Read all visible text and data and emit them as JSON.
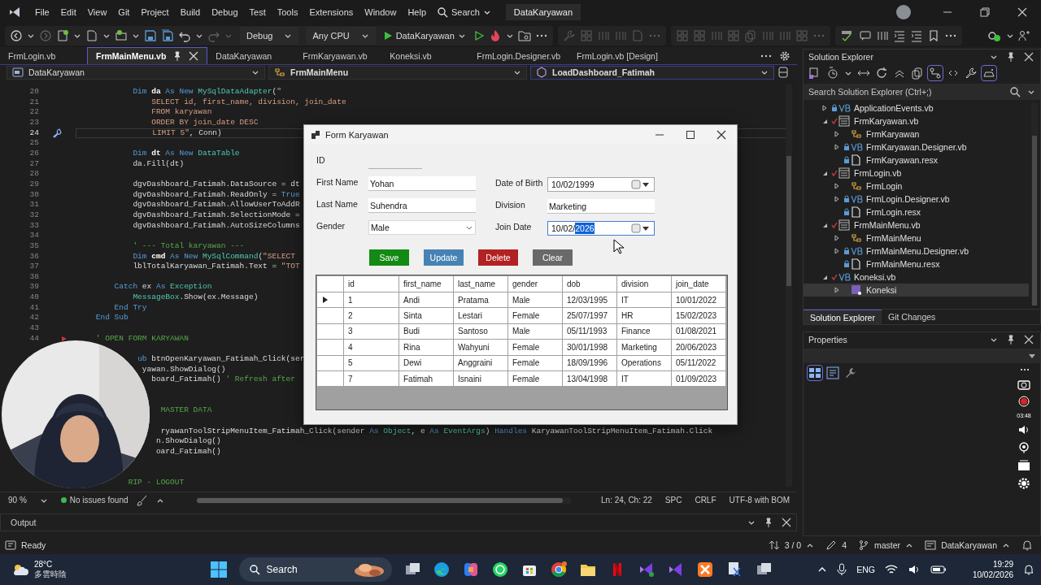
{
  "window": {
    "title": "DataKaryawan"
  },
  "menu": [
    "File",
    "Edit",
    "View",
    "Git",
    "Project",
    "Build",
    "Debug",
    "Test",
    "Tools",
    "Extensions",
    "Window",
    "Help"
  ],
  "search": {
    "label": "Search"
  },
  "toolbar": {
    "forward": {
      "disabled": true
    },
    "redo": {
      "disabled": true
    },
    "debug_tools": {
      "disabled": true
    },
    "configuration": "Debug",
    "platform": "Any CPU",
    "start": "DataKaryawan"
  },
  "editor_tabs": [
    {
      "label": "FrmLogin.vb",
      "selected": false
    },
    {
      "label": "FrmMainMenu.vb",
      "selected": true
    },
    {
      "label": "DataKaryawan",
      "selected": false
    },
    {
      "label": "FrmKaryawan.vb",
      "selected": false
    },
    {
      "label": "Koneksi.vb",
      "selected": false
    },
    {
      "label": "FrmLogin.Designer.vb",
      "selected": false
    },
    {
      "label": "FrmLogin.vb [Design]",
      "selected": false
    }
  ],
  "nav_bar": {
    "project": "DataKaryawan",
    "class": "FrmMainMenu",
    "member": "LoadDashboard_Fatimah"
  },
  "code_lines": [
    {
      "kind": "code",
      "number": "20",
      "tokens": [
        {
          "kind": "keyword",
          "text": "            Dim "
        },
        {
          "kind": "local",
          "text": "da"
        },
        {
          "kind": "keyword",
          "text": " As New "
        },
        {
          "kind": "type",
          "text": "MySqlDataAdapter"
        },
        {
          "kind": "plain",
          "text": "("
        },
        {
          "kind": "string",
          "text": "\""
        }
      ]
    },
    {
      "kind": "code",
      "number": "21",
      "tokens": [
        {
          "kind": "string",
          "text": "                SELECT id, first_name, division, join_date"
        }
      ]
    },
    {
      "kind": "code",
      "number": "22",
      "tokens": [
        {
          "kind": "string",
          "text": "                FROM karyawan"
        }
      ]
    },
    {
      "kind": "code",
      "number": "23",
      "tokens": [
        {
          "kind": "string",
          "text": "                ORDER BY join_date DESC"
        }
      ]
    },
    {
      "kind": "code",
      "number": "24",
      "current": true,
      "tokens": [
        {
          "kind": "string",
          "text": "                LIMIT 5\""
        },
        {
          "kind": "plain",
          "text": ", Conn)"
        }
      ]
    },
    {
      "kind": "blank",
      "number": "25"
    },
    {
      "kind": "code",
      "number": "26",
      "tokens": [
        {
          "kind": "keyword",
          "text": "            Dim "
        },
        {
          "kind": "local",
          "text": "dt"
        },
        {
          "kind": "keyword",
          "text": " As New "
        },
        {
          "kind": "type",
          "text": "DataTable"
        }
      ]
    },
    {
      "kind": "code",
      "number": "27",
      "tokens": [
        {
          "kind": "plain",
          "text": "            da.Fill(dt)"
        }
      ]
    },
    {
      "kind": "blank",
      "number": "28"
    },
    {
      "kind": "code",
      "number": "29",
      "tokens": [
        {
          "kind": "plain",
          "text": "            dgvDashboard_Fatimah.DataSource = dt"
        }
      ]
    },
    {
      "kind": "code",
      "number": "30",
      "tokens": [
        {
          "kind": "plain",
          "text": "            dgvDashboard_Fatimah.ReadOnly = "
        },
        {
          "kind": "keyword",
          "text": "True"
        }
      ]
    },
    {
      "kind": "code",
      "number": "31",
      "tokens": [
        {
          "kind": "plain",
          "text": "            dgvDashboard_Fatimah.AllowUserToAddR"
        }
      ]
    },
    {
      "kind": "code",
      "number": "32",
      "tokens": [
        {
          "kind": "plain",
          "text": "            dgvDashboard_Fatimah.SelectionMode ="
        }
      ]
    },
    {
      "kind": "code",
      "number": "33",
      "tokens": [
        {
          "kind": "plain",
          "text": "            dgvDashboard_Fatimah.AutoSizeColumns"
        }
      ]
    },
    {
      "kind": "blank",
      "number": "34"
    },
    {
      "kind": "code",
      "number": "35",
      "tokens": [
        {
          "kind": "comment",
          "text": "            ' --- Total karyawan ---"
        }
      ]
    },
    {
      "kind": "code",
      "number": "36",
      "tokens": [
        {
          "kind": "keyword",
          "text": "            Dim "
        },
        {
          "kind": "local",
          "text": "cmd"
        },
        {
          "kind": "keyword",
          "text": " As New "
        },
        {
          "kind": "type",
          "text": "MySqlCommand"
        },
        {
          "kind": "plain",
          "text": "("
        },
        {
          "kind": "string",
          "text": "\"SELECT"
        }
      ]
    },
    {
      "kind": "code",
      "number": "37",
      "tokens": [
        {
          "kind": "plain",
          "text": "            lblTotalKaryawan_Fatimah.Text = "
        },
        {
          "kind": "string",
          "text": "\"TOT"
        }
      ]
    },
    {
      "kind": "blank",
      "number": "38"
    },
    {
      "kind": "code",
      "number": "39",
      "tokens": [
        {
          "kind": "keyword",
          "text": "        Catch "
        },
        {
          "kind": "plain",
          "text": "ex "
        },
        {
          "kind": "keyword",
          "text": "As "
        },
        {
          "kind": "type",
          "text": "Exception"
        }
      ]
    },
    {
      "kind": "code",
      "number": "40",
      "tokens": [
        {
          "kind": "type",
          "text": "            MessageBox"
        },
        {
          "kind": "plain",
          "text": ".Show(ex.Message)"
        }
      ]
    },
    {
      "kind": "code",
      "number": "41",
      "tokens": [
        {
          "kind": "keyword",
          "text": "        End Try"
        }
      ]
    },
    {
      "kind": "code",
      "number": "42",
      "tokens": [
        {
          "kind": "keyword",
          "text": "    End Sub"
        }
      ]
    },
    {
      "kind": "blank",
      "number": "43"
    },
    {
      "kind": "code",
      "number": "44",
      "marker": true,
      "tokens": [
        {
          "kind": "comment",
          "text": "    ' OPEN FORM KARYAWAN"
        }
      ]
    },
    {
      "kind": "blank"
    },
    {
      "kind": "code",
      "tokens": [
        {
          "kind": "keyword",
          "text": "             ub "
        },
        {
          "kind": "plain",
          "text": "btnOpenKaryawan_Fatimah_Click(ser"
        }
      ]
    },
    {
      "kind": "code",
      "tokens": [
        {
          "kind": "plain",
          "text": "              yawan.ShowDialog()"
        }
      ]
    },
    {
      "kind": "code",
      "tokens": [
        {
          "kind": "plain",
          "text": "                board_Fatimah() "
        },
        {
          "kind": "comment",
          "text": "' Refresh after"
        }
      ]
    },
    {
      "kind": "blank"
    },
    {
      "kind": "blank"
    },
    {
      "kind": "code",
      "tokens": [
        {
          "kind": "comment",
          "text": "                  MASTER DATA"
        }
      ]
    },
    {
      "kind": "blank"
    },
    {
      "kind": "code",
      "tokens": [
        {
          "kind": "plain",
          "text": "                  ryawanToolStripMenuItem_Fatimah_Click(sender "
        },
        {
          "kind": "keyword",
          "text": "As "
        },
        {
          "kind": "type",
          "text": "Object"
        },
        {
          "kind": "plain",
          "text": ", e "
        },
        {
          "kind": "keyword",
          "text": "As "
        },
        {
          "kind": "type",
          "text": "EventArgs"
        },
        {
          "kind": "plain",
          "text": ") "
        },
        {
          "kind": "keyword",
          "text": "Handles "
        },
        {
          "kind": "plain",
          "text": "KaryawanToolStripMenuItem_Fatimah.Click"
        }
      ]
    },
    {
      "kind": "code",
      "tokens": [
        {
          "kind": "plain",
          "text": "                 n.ShowDialog()"
        }
      ]
    },
    {
      "kind": "code",
      "tokens": [
        {
          "kind": "plain",
          "text": "                 oard_Fatimah()"
        }
      ]
    },
    {
      "kind": "blank"
    },
    {
      "kind": "blank"
    },
    {
      "kind": "code",
      "tokens": [
        {
          "kind": "comment",
          "text": "           RIP - LOGOUT"
        }
      ]
    }
  ],
  "editor_status": {
    "zoom": "90 %",
    "issues": "No issues found",
    "position": "Ln: 24, Ch: 22",
    "indent": "SPC",
    "line_endings": "CRLF",
    "encoding": "UTF-8 with BOM"
  },
  "output_panel": {
    "title": "Output"
  },
  "solution_explorer": {
    "title": "Solution Explorer",
    "search_placeholder": "Search Solution Explorer (Ctrl+;)",
    "items": [
      {
        "label": "ApplicationEvents.vb",
        "kind": "vb",
        "locked": true,
        "modified": false,
        "expanded": false,
        "selected": false
      },
      {
        "label": "FrmKaryawan.vb",
        "kind": "form",
        "locked": false,
        "modified": true,
        "expanded": true,
        "selected": false,
        "children": [
          {
            "label": "FrmKaryawan",
            "kind": "class",
            "locked": false,
            "modified": false,
            "expanded": false,
            "selected": false
          },
          {
            "label": "FrmKaryawan.Designer.vb",
            "kind": "vb",
            "locked": true,
            "modified": false,
            "expanded": false,
            "selected": false
          },
          {
            "label": "FrmKaryawan.resx",
            "kind": "resx",
            "locked": true,
            "modified": false,
            "selected": false
          }
        ]
      },
      {
        "label": "FrmLogin.vb",
        "kind": "form",
        "locked": false,
        "modified": true,
        "expanded": true,
        "selected": false,
        "children": [
          {
            "label": "FrmLogin",
            "kind": "class",
            "locked": false,
            "modified": false,
            "expanded": false,
            "selected": false
          },
          {
            "label": "FrmLogin.Designer.vb",
            "kind": "vb",
            "locked": true,
            "modified": false,
            "expanded": false,
            "selected": false
          },
          {
            "label": "FrmLogin.resx",
            "kind": "resx",
            "locked": true,
            "modified": false,
            "selected": false
          }
        ]
      },
      {
        "label": "FrmMainMenu.vb",
        "kind": "form",
        "locked": false,
        "modified": true,
        "expanded": true,
        "selected": false,
        "children": [
          {
            "label": "FrmMainMenu",
            "kind": "class",
            "locked": false,
            "modified": false,
            "expanded": false,
            "selected": false
          },
          {
            "label": "FrmMainMenu.Designer.vb",
            "kind": "vb",
            "locked": true,
            "modified": false,
            "expanded": false,
            "selected": false
          },
          {
            "label": "FrmMainMenu.resx",
            "kind": "resx",
            "locked": true,
            "modified": false,
            "selected": false
          }
        ]
      },
      {
        "label": "Koneksi.vb",
        "kind": "vb",
        "locked": false,
        "modified": true,
        "expanded": true,
        "selected": false,
        "children": [
          {
            "label": "Koneksi",
            "kind": "module",
            "locked": false,
            "modified": false,
            "expanded": false,
            "selected": true
          }
        ]
      }
    ],
    "tabs": [
      {
        "label": "Solution Explorer",
        "selected": true
      },
      {
        "label": "Git Changes",
        "selected": false
      }
    ]
  },
  "properties": {
    "title": "Properties"
  },
  "recorder": {
    "timer": "03:48"
  },
  "form": {
    "title": "Form Karyawan",
    "left_fields": [
      {
        "label": "ID",
        "kind": "underline"
      },
      {
        "label": "First Name",
        "kind": "text",
        "value": "Yohan"
      },
      {
        "label": "Last Name",
        "kind": "text",
        "value": "Suhendra"
      },
      {
        "label": "Gender",
        "kind": "combo",
        "value": "Male"
      }
    ],
    "right_fields": [
      {
        "label": "Date of Birth",
        "kind": "date",
        "focused": false,
        "value_parts": [
          {
            "text": "10/02/1999",
            "highlighted": false
          }
        ]
      },
      {
        "label": "Division",
        "kind": "text",
        "value": "Marketing"
      },
      {
        "label": "Join Date",
        "kind": "date",
        "focused": true,
        "value_parts": [
          {
            "text": "10/02/",
            "highlighted": false
          },
          {
            "text": "2026",
            "highlighted": true
          }
        ]
      }
    ],
    "buttons": [
      {
        "label": "Save",
        "color": "#138a13"
      },
      {
        "label": "Update",
        "color": "#4682b4"
      },
      {
        "label": "Delete",
        "color": "#b22222"
      },
      {
        "label": "Clear",
        "color": "#696969"
      }
    ],
    "grid": {
      "columns": [
        "id",
        "first_name",
        "last_name",
        "gender",
        "dob",
        "division",
        "join_date"
      ],
      "rows": [
        {
          "current": true,
          "cells": [
            "1",
            "Andi",
            "Pratama",
            "Male",
            "12/03/1995",
            "IT",
            "10/01/2022"
          ]
        },
        {
          "current": false,
          "cells": [
            "2",
            "Sinta",
            "Lestari",
            "Female",
            "25/07/1997",
            "HR",
            "15/02/2023"
          ]
        },
        {
          "current": false,
          "cells": [
            "3",
            "Budi",
            "Santoso",
            "Male",
            "05/11/1993",
            "Finance",
            "01/08/2021"
          ]
        },
        {
          "current": false,
          "cells": [
            "4",
            "Rina",
            "Wahyuni",
            "Female",
            "30/01/1998",
            "Marketing",
            "20/06/2023"
          ]
        },
        {
          "current": false,
          "cells": [
            "5",
            "Dewi",
            "Anggraini",
            "Female",
            "18/09/1996",
            "Operations",
            "05/11/2022"
          ]
        },
        {
          "current": false,
          "cells": [
            "7",
            "Fatimah",
            "Isnaini",
            "Female",
            "13/04/1998",
            "IT",
            "01/09/2023"
          ]
        }
      ]
    }
  },
  "status_bar": {
    "state": "Ready",
    "commits": "3 / 0",
    "changes": "4",
    "branch": "master",
    "repository": "DataKaryawan"
  },
  "taskbar": {
    "temperature": "28°C",
    "weather": "多雲時陰",
    "search": "Search",
    "language": "ENG",
    "time": "19:29",
    "date": "10/02/2026"
  }
}
